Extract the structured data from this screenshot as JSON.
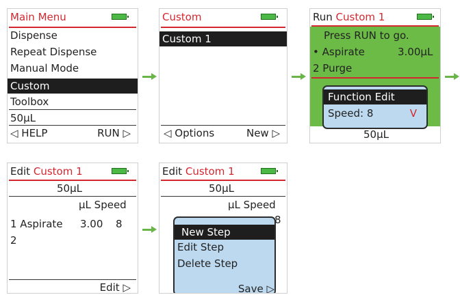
{
  "screens": {
    "main_menu": {
      "title": "Main Menu",
      "items": [
        "Dispense",
        "Repeat Dispense",
        "Manual Mode",
        "Custom",
        "Toolbox"
      ],
      "volume": "50µL",
      "left_soft": "◁ HELP",
      "right_soft": "RUN ▷"
    },
    "custom": {
      "title": "Custom",
      "items": [
        "Custom 1"
      ],
      "left_soft": "◁ Options",
      "right_soft": "New ▷"
    },
    "run": {
      "title_prefix": "Run",
      "title_name": "Custom 1",
      "instruction": "Press RUN to go.",
      "step1_name": "• Aspirate",
      "step1_value": "3.00µL",
      "step2": "2 Purge",
      "popup_title": "Function Edit",
      "popup_field": "Speed: 8",
      "popup_marker": "V",
      "volume": "50µL"
    },
    "edit": {
      "title_prefix": "Edit",
      "title_name": "Custom 1",
      "volume": "50µL",
      "col_header": "µL Speed",
      "row1_label": "1 Aspirate",
      "row1_value": "3.00",
      "row1_speed": "8",
      "row2_label": "2",
      "right_soft": "Edit ▷"
    },
    "edit_popup": {
      "title_prefix": "Edit",
      "title_name": "Custom 1",
      "volume": "50µL",
      "col_header": "µL Speed",
      "row1_speed": "8",
      "menu": [
        "New Step",
        "Edit Step",
        "Delete Step"
      ],
      "right_soft": "Save ▷"
    }
  },
  "colors": {
    "accent_red": "#d3272f",
    "battery_green": "#4cb846",
    "run_background": "#6cbb46",
    "popup_blue": "#bcd9ef",
    "arrow_green": "#6ab547",
    "selection": "#1e1e1e"
  },
  "icons": {
    "battery": "battery-icon",
    "flow_arrow": "arrow-right-icon"
  }
}
